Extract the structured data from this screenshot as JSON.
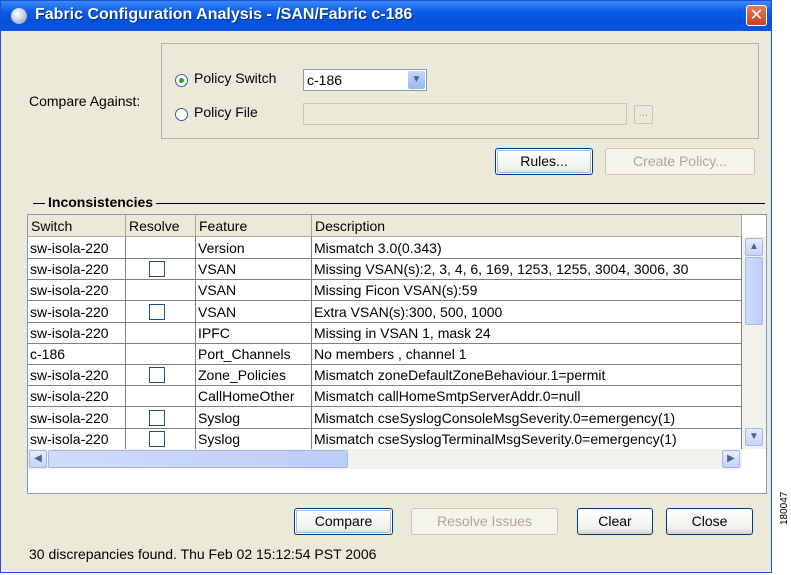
{
  "window": {
    "title": "Fabric Configuration Analysis - /SAN/Fabric c-186",
    "close_label": "✕"
  },
  "compare": {
    "label": "Compare Against:",
    "policy_switch_label": "Policy Switch",
    "policy_switch_value": "c-186",
    "policy_file_label": "Policy File",
    "policy_file_value": "",
    "browse_label": "...",
    "policy_switch_selected": true
  },
  "buttons": {
    "rules": "Rules...",
    "create_policy": "Create Policy...",
    "compare": "Compare",
    "resolve_issues": "Resolve Issues",
    "clear": "Clear",
    "close": "Close"
  },
  "inconsistencies": {
    "title": "Inconsistencies",
    "columns": [
      "Switch",
      "Resolve",
      "Feature",
      "Description"
    ],
    "rows": [
      {
        "switch": "sw-isola-220",
        "resolve": false,
        "feature": "Version",
        "description": "Mismatch 3.0(0.343)"
      },
      {
        "switch": "sw-isola-220",
        "resolve": true,
        "feature": "VSAN",
        "description": "Missing VSAN(s):2, 3, 4, 6, 169, 1253, 1255, 3004, 3006, 30"
      },
      {
        "switch": "sw-isola-220",
        "resolve": false,
        "feature": "VSAN",
        "description": "Missing Ficon VSAN(s):59"
      },
      {
        "switch": "sw-isola-220",
        "resolve": true,
        "feature": "VSAN",
        "description": "Extra VSAN(s):300, 500, 1000"
      },
      {
        "switch": "sw-isola-220",
        "resolve": false,
        "feature": "IPFC",
        "description": "Missing in VSAN 1, mask 24"
      },
      {
        "switch": "c-186",
        "resolve": false,
        "feature": "Port_Channels",
        "description": "No members , channel 1"
      },
      {
        "switch": "sw-isola-220",
        "resolve": true,
        "feature": "Zone_Policies",
        "description": "Mismatch zoneDefaultZoneBehaviour.1=permit"
      },
      {
        "switch": "sw-isola-220",
        "resolve": false,
        "feature": "CallHomeOther",
        "description": "Mismatch callHomeSmtpServerAddr.0=null"
      },
      {
        "switch": "sw-isola-220",
        "resolve": true,
        "feature": "Syslog",
        "description": "Mismatch cseSyslogConsoleMsgSeverity.0=emergency(1)"
      },
      {
        "switch": "sw-isola-220",
        "resolve": true,
        "feature": "Syslog",
        "description": "Mismatch cseSyslogTerminalMsgSeverity.0=emergency(1)"
      }
    ]
  },
  "status_text": "30 discrepancies found. Thu Feb 02 15:12:54 PST 2006",
  "side_number": "180047",
  "icons": {
    "window": "app-globe-icon",
    "close": "close-icon",
    "combo": "chevron-down-icon"
  }
}
